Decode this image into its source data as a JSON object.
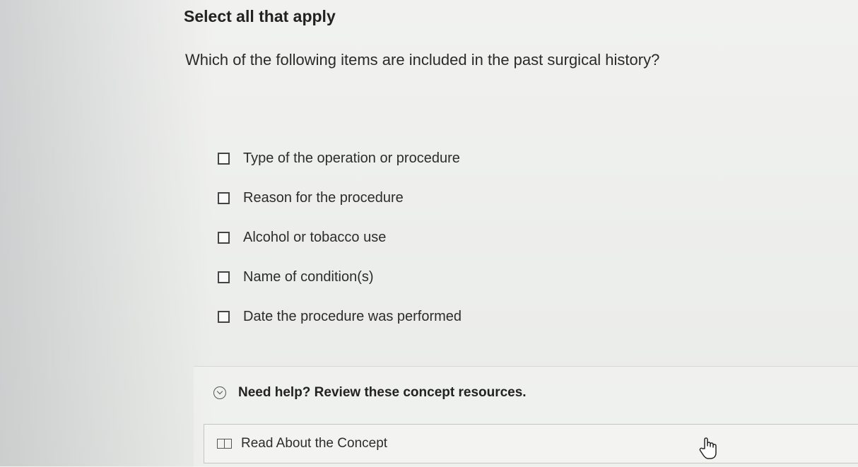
{
  "question_block": {
    "heading": "Select all that apply",
    "prompt": "Which of the following items are included in the past surgical history?"
  },
  "options": [
    {
      "label": "Type of the operation or procedure",
      "checked": false
    },
    {
      "label": "Reason for the procedure",
      "checked": false
    },
    {
      "label": "Alcohol or tobacco use",
      "checked": false
    },
    {
      "label": "Name of condition(s)",
      "checked": false
    },
    {
      "label": "Date the procedure was performed",
      "checked": false
    }
  ],
  "help": {
    "toggle_label": "Need help? Review these concept resources.",
    "toggle_icon": "chevron-down-icon",
    "resources": [
      {
        "label": "Read About the Concept",
        "icon": "book-icon"
      }
    ]
  },
  "cursor": {
    "icon": "hand-cursor-icon"
  }
}
